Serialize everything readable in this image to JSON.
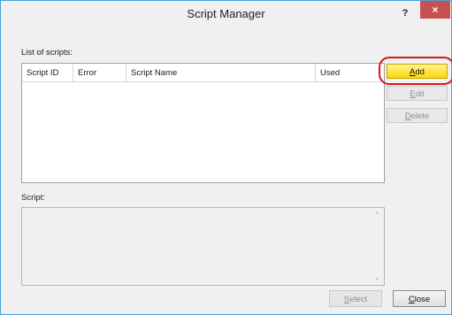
{
  "window": {
    "title": "Script Manager",
    "help_glyph": "?",
    "close_glyph": "×",
    "accent_color": "#4aa0d6",
    "close_color": "#c75050"
  },
  "list": {
    "label": "List of scripts:",
    "columns": [
      "Script ID",
      "Error",
      "Script Name",
      "Used"
    ],
    "rows": []
  },
  "side_buttons": {
    "add": {
      "label": "Add",
      "underline": "A",
      "rest": "dd"
    },
    "edit": {
      "label": "Edit",
      "underline": "E",
      "rest": "dit"
    },
    "delete": {
      "label": "Delete",
      "underline": "D",
      "rest": "elete"
    }
  },
  "highlight_color": "#d11a1a",
  "script": {
    "label": "Script:",
    "content": "",
    "scroll_up_icon": "chevron-up-icon",
    "scroll_down_icon": "chevron-down-icon"
  },
  "bottom_buttons": {
    "select": {
      "label": "Select",
      "underline": "S",
      "rest": "elect"
    },
    "close": {
      "label": "Close",
      "underline": "C",
      "rest": "lose"
    }
  }
}
